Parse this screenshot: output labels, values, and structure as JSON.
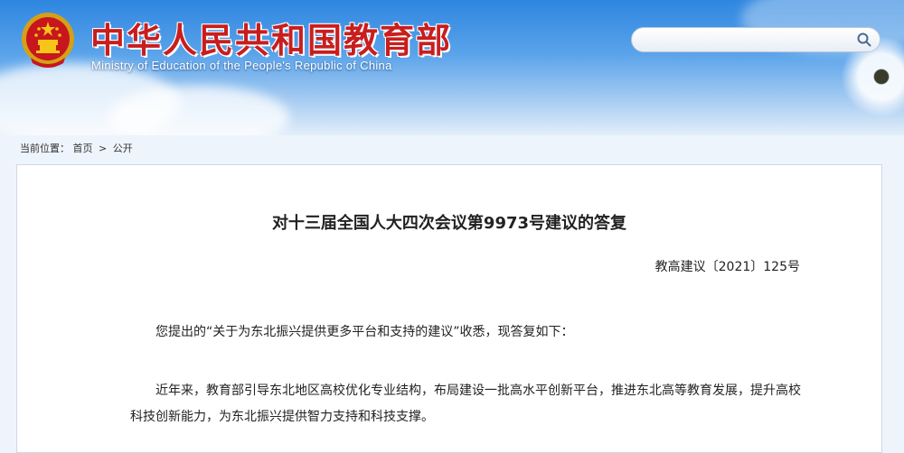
{
  "header": {
    "site_title": "中华人民共和国教育部",
    "site_subtitle": "Ministry of Education of the People's Republic of China",
    "search_placeholder": ""
  },
  "breadcrumb": {
    "prefix": "当前位置：",
    "items": [
      "首页",
      "公开"
    ],
    "separator": ">"
  },
  "document": {
    "title": "对十三届全国人大四次会议第9973号建议的答复",
    "number": "教高建议〔2021〕125号",
    "paragraphs": [
      "您提出的“关于为东北振兴提供更多平台和支持的建议”收悉，现答复如下：",
      "近年来，教育部引导东北地区高校优化专业结构，布局建设一批高水平创新平台，推进东北高等教育发展，提升高校科技创新能力，为东北振兴提供智力支持和科技支撑。"
    ]
  },
  "icons": {
    "emblem": "national-emblem-icon",
    "search": "search-icon"
  },
  "colors": {
    "title_red": "#c81e1e",
    "banner_blue": "#2f86e0"
  }
}
